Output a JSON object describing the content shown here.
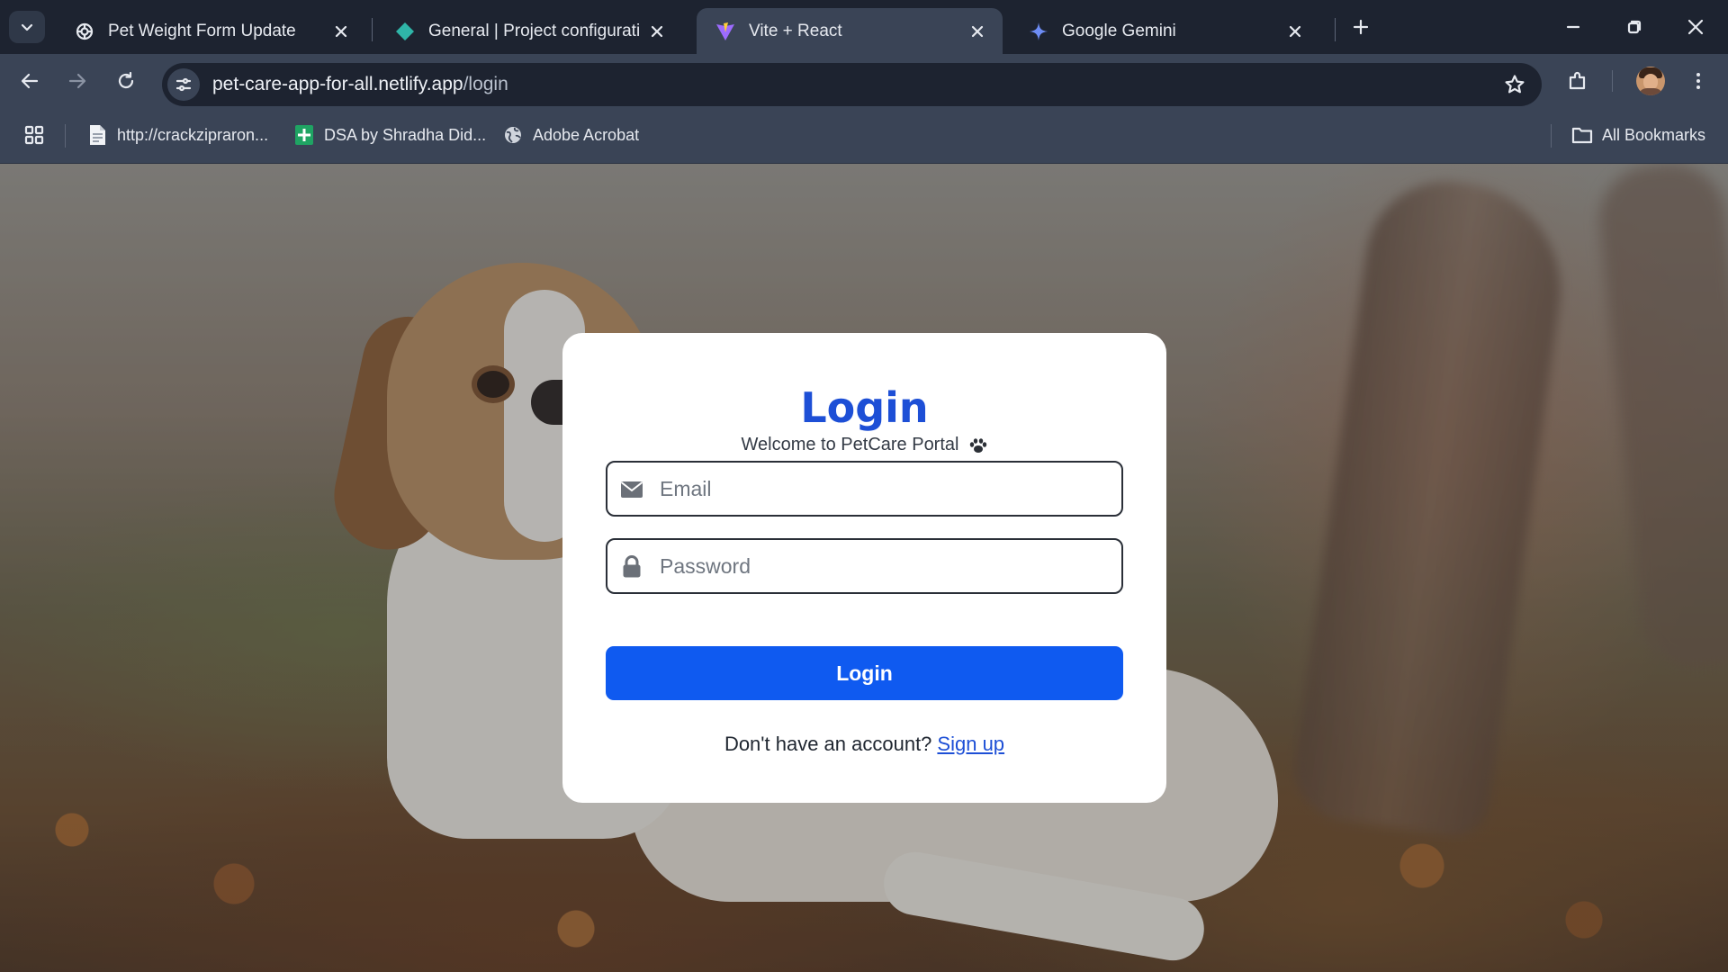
{
  "browser": {
    "tabs": [
      {
        "title": "Pet Weight Form Update",
        "favicon": "openai-icon",
        "active": false
      },
      {
        "title": "General | Project configuration |",
        "favicon": "netlify-icon",
        "active": false
      },
      {
        "title": "Vite + React",
        "favicon": "vite-icon",
        "active": true
      },
      {
        "title": "Google Gemini",
        "favicon": "gemini-icon",
        "active": false
      }
    ],
    "address": {
      "host": "pet-care-app-for-all.netlify.app",
      "path": "/login"
    },
    "bookmarks": [
      {
        "label": "http://crackzipraron...",
        "icon": "page-icon"
      },
      {
        "label": "DSA by Shradha Did...",
        "icon": "sheets-icon"
      },
      {
        "label": "Adobe Acrobat",
        "icon": "globe-icon"
      }
    ],
    "all_bookmarks_label": "All Bookmarks"
  },
  "login": {
    "title": "Login",
    "subtitle": "Welcome to PetCare Portal",
    "email_placeholder": "Email",
    "email_value": "",
    "password_placeholder": "Password",
    "password_value": "",
    "button_label": "Login",
    "signup_prompt": "Don't have an account?",
    "signup_link": "Sign up"
  },
  "colors": {
    "accent": "#0f5af0",
    "title": "#1d4fd6",
    "chrome_dark": "#1d2330",
    "chrome_toolbar": "#3a4456"
  }
}
